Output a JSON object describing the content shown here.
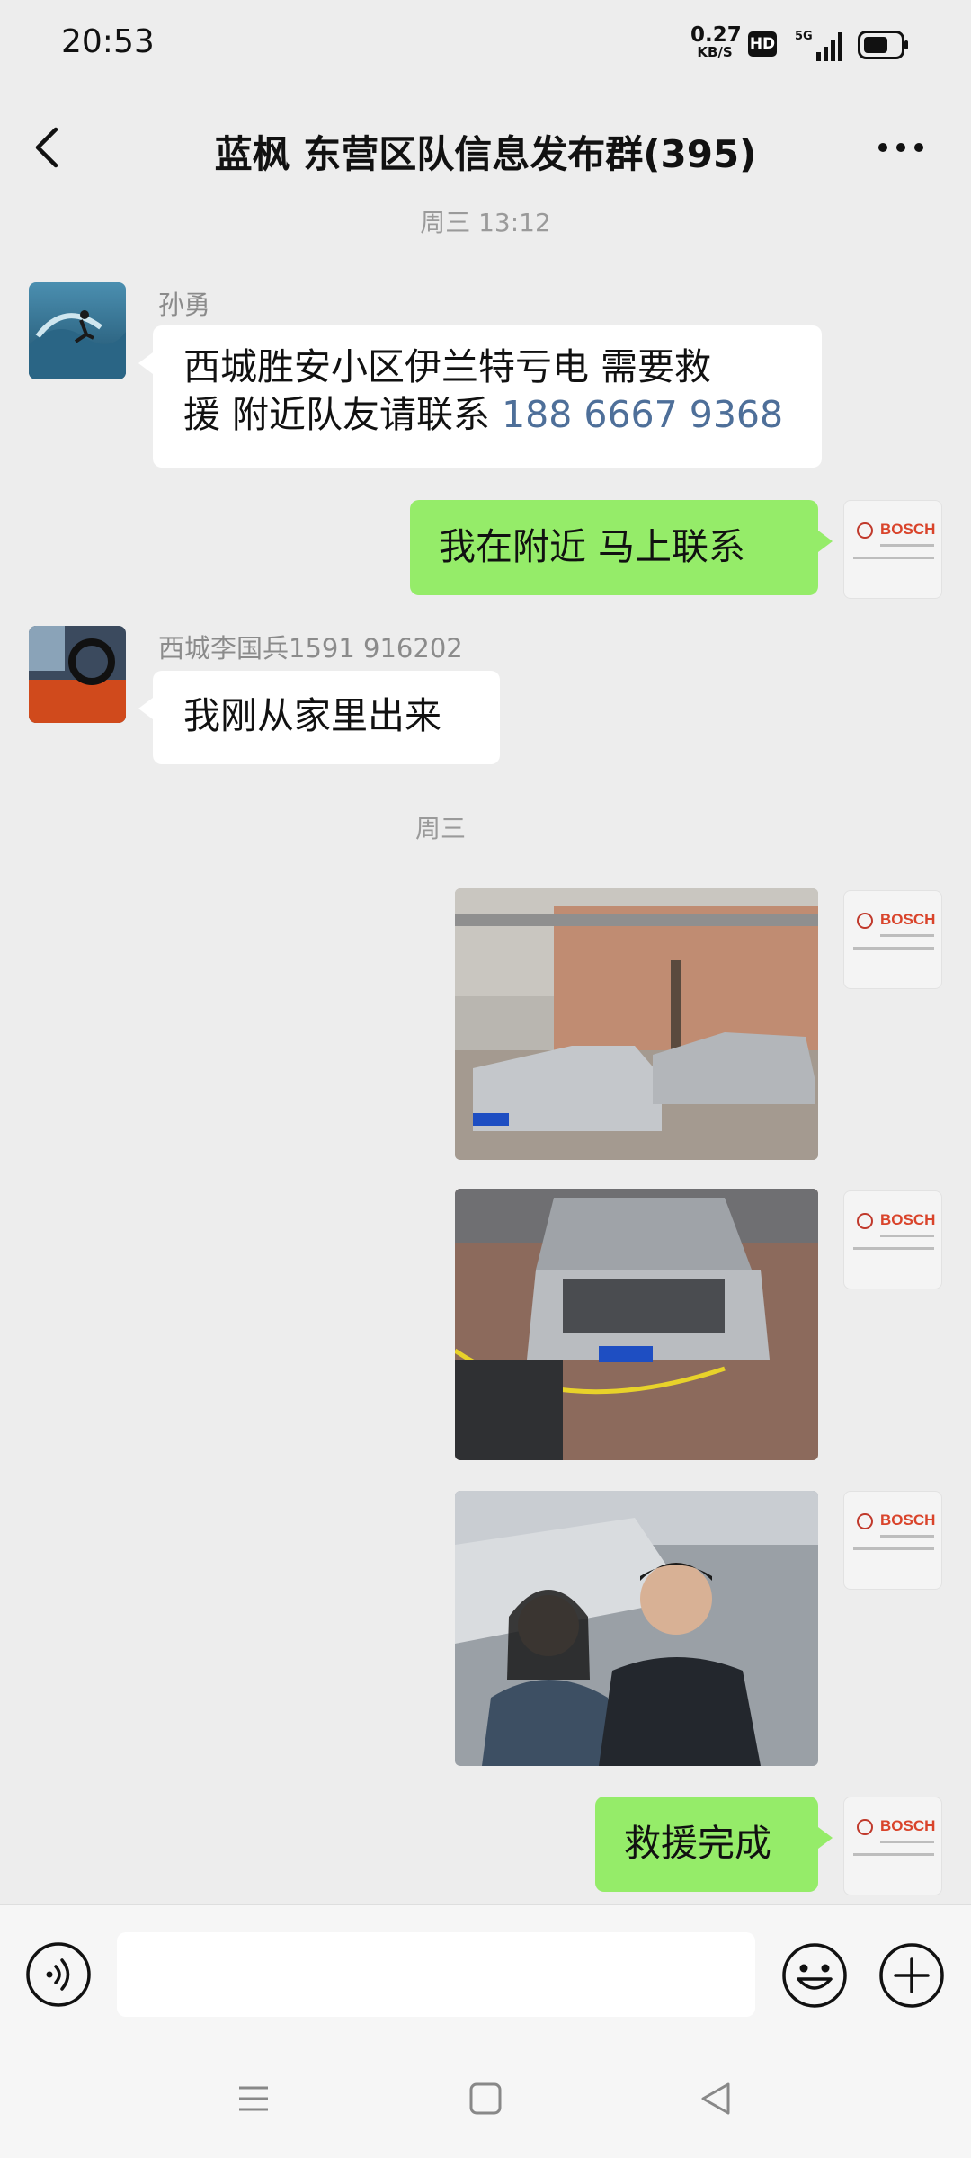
{
  "status_bar": {
    "time": "20:53",
    "net_speed_value": "0.27",
    "net_speed_unit": "KB/S",
    "hd_label": "HD",
    "network_label": "5G"
  },
  "header": {
    "title": "蓝枫 东营区队信息发布群(395)",
    "back_icon": "chevron-left-icon",
    "more_icon": "more-dots-icon"
  },
  "messages": {
    "timestamp_1": "周三 13:12",
    "msg1_sender": "孙勇",
    "msg1_text_line1": "西城胜安小区伊兰特亏电 需要救",
    "msg1_text_line2": "援 附近队友请联系 ",
    "msg1_phone": "188 6667 9368",
    "msg2_text": "我在附近  马上联系",
    "msg3_sender": "西城李国兵1591 916202",
    "msg3_text": "我刚从家里出来",
    "timestamp_2": "周三",
    "self_avatar_brand": "BOSCH",
    "msg8_text": "救援完成"
  },
  "input_bar": {
    "input_value": "",
    "voice_icon": "voice-icon",
    "emoji_icon": "emoji-icon",
    "plus_icon": "plus-icon"
  },
  "colors": {
    "background": "#ededed",
    "outgoing_bubble": "#95ec69",
    "incoming_bubble": "#ffffff",
    "phone_link": "#4e6f99"
  }
}
